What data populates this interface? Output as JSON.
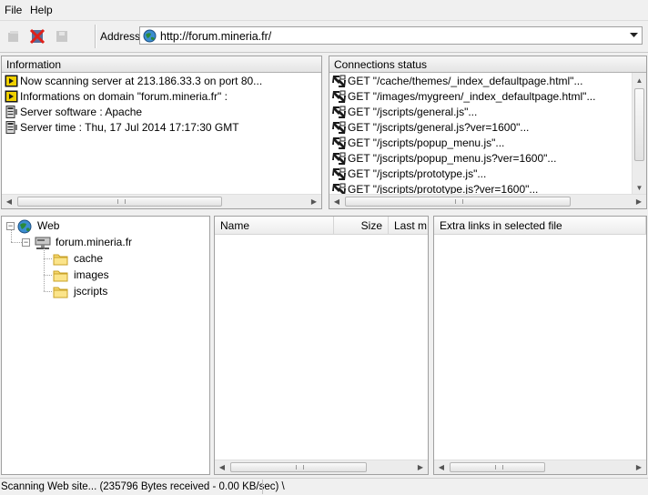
{
  "menu": {
    "file": "File",
    "help": "Help"
  },
  "toolbar": {
    "address_label": "Address",
    "address_value": "http://forum.mineria.fr/"
  },
  "information": {
    "title": "Information",
    "rows": [
      {
        "icon": "play-icon",
        "text": "Now scanning server at 213.186.33.3 on port 80..."
      },
      {
        "icon": "play-icon",
        "text": "Informations on domain \"forum.mineria.fr\" :"
      },
      {
        "icon": "server-info-icon",
        "text": "Server software : Apache"
      },
      {
        "icon": "server-info-icon",
        "text": "Server time : Thu, 17 Jul 2014 17:17:30 GMT"
      }
    ]
  },
  "connections": {
    "title": "Connections status",
    "rows": [
      "GET \"/cache/themes/_index_defaultpage.html\"...",
      "GET \"/images/mygreen/_index_defaultpage.html\"...",
      "GET \"/jscripts/general.js\"...",
      "GET \"/jscripts/general.js?ver=1600\"...",
      "GET \"/jscripts/popup_menu.js\"...",
      "GET \"/jscripts/popup_menu.js?ver=1600\"...",
      "GET \"/jscripts/prototype.js\"...",
      "GET \"/jscripts/prototype.js?ver=1600\"..."
    ]
  },
  "tree": {
    "root": "Web",
    "server": "forum.mineria.fr",
    "folders": [
      "cache",
      "images",
      "jscripts"
    ]
  },
  "files": {
    "columns": {
      "name": "Name",
      "size": "Size",
      "last": "Last m"
    }
  },
  "extra": {
    "title": "Extra links in selected file"
  },
  "status": {
    "text": "Scanning Web site... (235796 Bytes received - 0.00 KB/sec) \\"
  },
  "colors": {
    "folder": "#f5d76e",
    "play": "#f0d000",
    "globe": "#2a8a3a"
  }
}
